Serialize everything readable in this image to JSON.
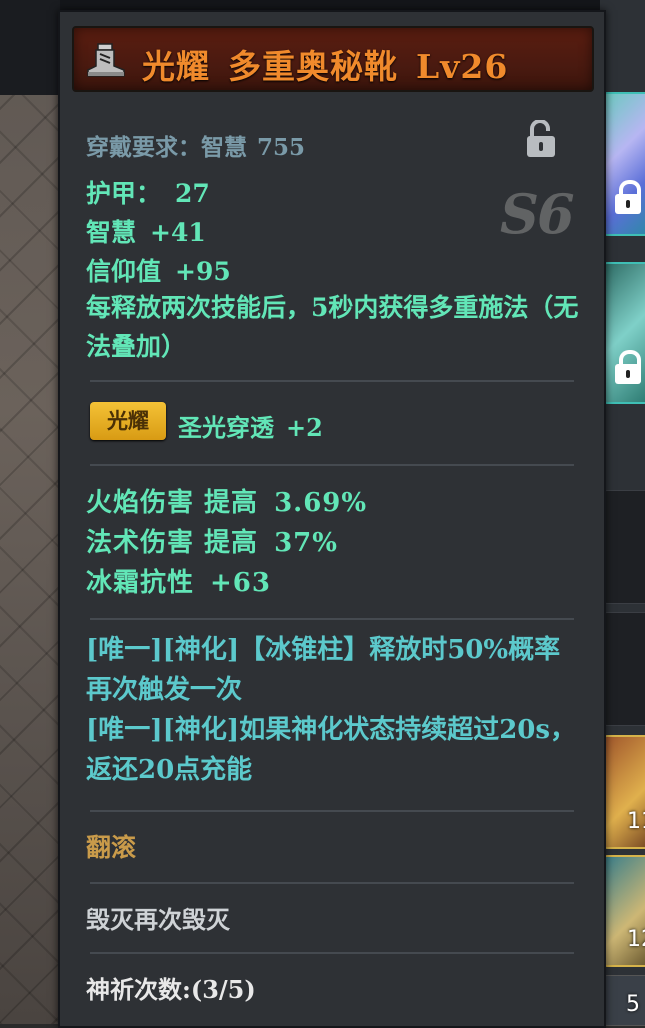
{
  "item": {
    "quality": "光耀",
    "name": "多重奥秘靴",
    "level": "Lv26",
    "icon": "boot-icon",
    "grade": "S6",
    "requirement_label": "穿戴要求：智慧",
    "requirement_value": "755",
    "lock_icon": "unlocked-padlock-icon"
  },
  "base_stats": [
    {
      "label": "护甲：",
      "value": "27"
    },
    {
      "label": "智慧",
      "value": "+41"
    },
    {
      "label": "信仰值",
      "value": "+95"
    }
  ],
  "base_effect": "每释放两次技能后，5秒内获得多重施法（无法叠加）",
  "skill_bonus": {
    "badge": "光耀",
    "skill": "圣光穿透",
    "value": "+2"
  },
  "affixes": [
    {
      "label": "火焰伤害 提高",
      "value": "3.69%"
    },
    {
      "label": "法术伤害 提高",
      "value": "37%"
    },
    {
      "label": "冰霜抗性",
      "value": "+63"
    }
  ],
  "unique_effects": [
    "[唯一][神化]【冰锥柱】释放时50%概率再次触发一次",
    "[唯一][神化]如果神化状态持续超过20s，返还20点充能"
  ],
  "roll_label": "翻滚",
  "destroy_text": "毁灭再次毁灭",
  "prayer": {
    "label": "神祈次数:",
    "value": "(3/5)"
  },
  "side_slots": [
    "11",
    "12",
    "5"
  ],
  "colors": {
    "stat_green": "#62e6b7",
    "unique_cyan": "#5cc9cc",
    "title_orange": "#f08a2c",
    "badge_gold": "#f4c236",
    "roll_gold": "#c99b4a"
  }
}
